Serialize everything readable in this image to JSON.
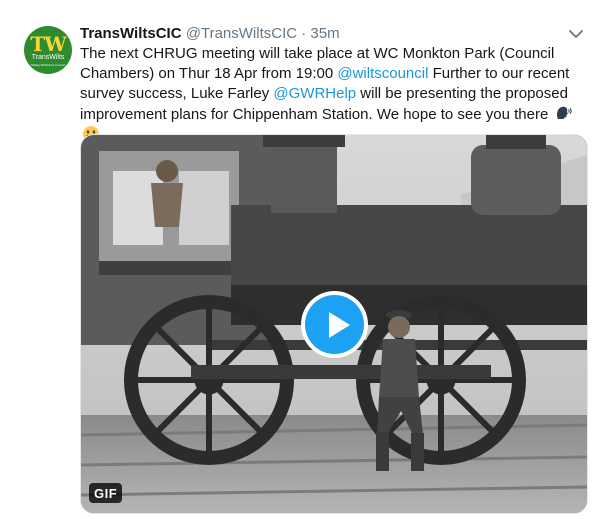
{
  "tweet": {
    "display_name": "TransWiltsCIC",
    "handle": "@TransWiltsCIC",
    "separator": "·",
    "time": "35m",
    "text_1": "The next CHRUG meeting will take place at WC Monkton Park (Council Chambers) on Thur 18 Apr from 19:00 ",
    "mention_1": "@wiltscouncil",
    "text_2": " Further to our recent survey success, Luke Farley ",
    "mention_2": "@GWRHelp",
    "text_3": " will be presenting the proposed improvement plans for Chippenham Station. We hope to see you there",
    "emojis": [
      "speaking-head-emoji",
      "grinning-face-emoji"
    ]
  },
  "avatar": {
    "logo_mark": "TW",
    "logo_text": "TransWilts",
    "logo_sub": "Taking Wiltshire's Council"
  },
  "media": {
    "badge": "GIF",
    "type": "animated-gif",
    "accent": "#1da1f2"
  },
  "icons": {
    "caret": "chevron-down-icon",
    "play": "play-icon"
  },
  "colors": {
    "link": "#1b95e0",
    "name": "#14171a",
    "meta": "#657786",
    "avatar_bg": "#2e8b2f",
    "avatar_mark": "#f6d53a"
  }
}
